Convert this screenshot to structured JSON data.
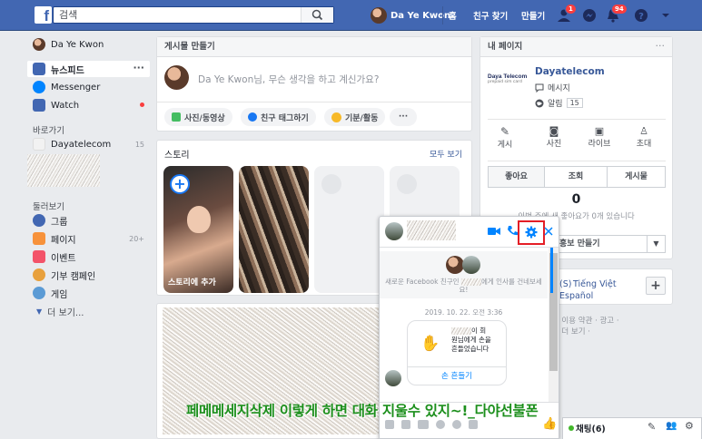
{
  "topbar": {
    "logo": "f",
    "search_placeholder": "검색",
    "profile_name": "Da Ye Kwon",
    "nav": {
      "home": "홈",
      "find_friends": "친구 찾기",
      "create": "만들기"
    },
    "badges": {
      "friend_requests": "1",
      "notifications": "94"
    }
  },
  "left": {
    "profile_name": "Da Ye Kwon",
    "items": [
      {
        "label": "뉴스피드"
      },
      {
        "label": "Messenger"
      },
      {
        "label": "Watch"
      }
    ],
    "shortcuts_title": "바로가기",
    "shortcuts": [
      {
        "label": "Dayatelecom",
        "count": "15"
      }
    ],
    "explore_title": "둘러보기",
    "explore": [
      {
        "label": "그룹",
        "count": ""
      },
      {
        "label": "페이지",
        "count": "20+"
      },
      {
        "label": "이벤트",
        "count": ""
      },
      {
        "label": "기부 캠페인",
        "count": ""
      },
      {
        "label": "게임",
        "count": ""
      }
    ],
    "see_more": "더 보기..."
  },
  "composer": {
    "title": "게시물 만들기",
    "placeholder_prefix": "Da Ye Kwon",
    "placeholder_rest": "님, 무슨 생각을 하고 계신가요?",
    "buttons": [
      "사진/동영상",
      "친구 태그하기",
      "기분/활동"
    ],
    "more": "···"
  },
  "stories": {
    "title": "스토리",
    "see_all": "모두 보기",
    "add_label": "스토리에 추가"
  },
  "my_page": {
    "title": "내 페이지",
    "brand": "Daya Telecom",
    "brand_sub": "prepaid sim card",
    "name": "Dayatelecom",
    "message": "메시지",
    "notifications": "알림",
    "notif_count": "15",
    "actions": [
      "게시",
      "사진",
      "라이브",
      "초대"
    ],
    "tabs": [
      "좋아요",
      "조회",
      "게시물"
    ],
    "likes_count": "0",
    "likes_desc": "이번 주에 새 좋아요가 0개 있습니다",
    "create_partial": "홍보 만들기"
  },
  "languages": {
    "lang1_partial": "(S)",
    "lang2": "Tiếng Việt",
    "lang3": "Español",
    "footer1": "· 이용 약관 · 광고 ·",
    "footer2": "· 더 보기 ·"
  },
  "chat": {
    "intro": "새로운 Facebook 친구인",
    "intro_suffix": "에게 인사를 건네보세요!",
    "date": "2019. 10. 22. 오전 3:36",
    "wave_text1": "이 회",
    "wave_text2": "원님에게 손을",
    "wave_text3": "흔들었습니다",
    "wave_button": "손 흔들기"
  },
  "bottom": {
    "chat_label": "채팅(6)"
  },
  "overlay_caption": "페메메세지삭제 이렇게 하면 대화 지울수 있지~!_다야선불폰",
  "colors": {
    "fb_blue": "#4267b2",
    "highlight_red": "#e41e26",
    "caption_green": "#1c8f1c",
    "link_blue": "#385898"
  }
}
